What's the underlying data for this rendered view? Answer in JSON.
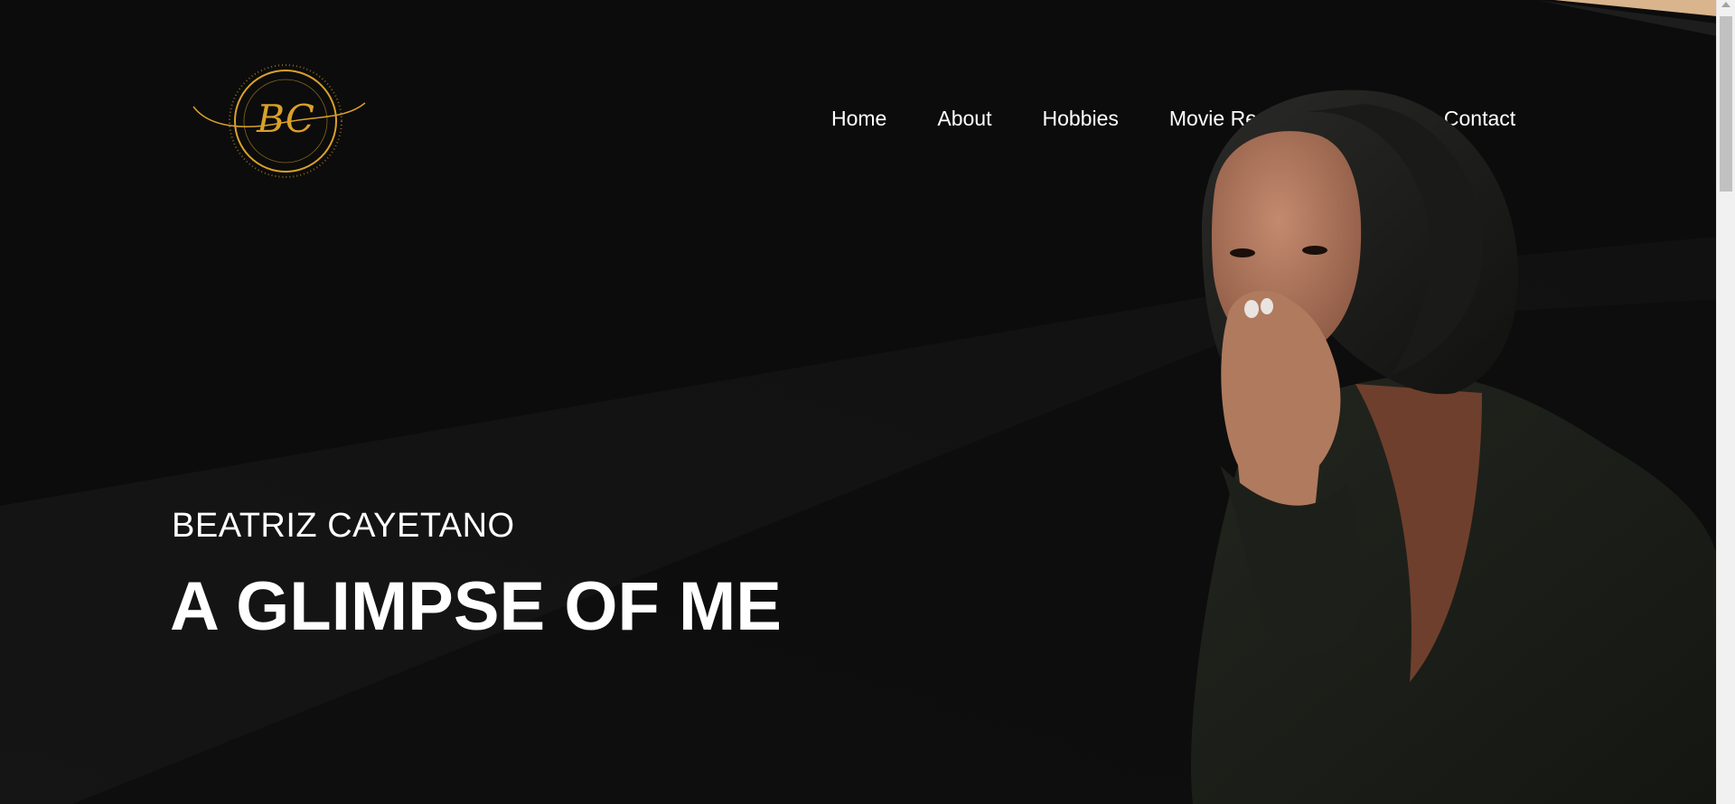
{
  "brand": {
    "logo_initials": "BC",
    "logo_ring_text": "BEATRIZ CAYETANO",
    "logo_color": "#d9a12a"
  },
  "nav": {
    "items": [
      "Home",
      "About",
      "Hobbies",
      "Movie Recommendation",
      "Contact"
    ]
  },
  "hero": {
    "subtitle": "BEATRIZ CAYETANO",
    "title": "A GLIMPSE OF ME"
  },
  "colors": {
    "background": "#0c0c0c",
    "text": "#ffffff",
    "accent": "#d9a12a",
    "corner_tan": "#d9b48c"
  },
  "icons": {
    "scroll_up": "triangle-up-icon"
  }
}
